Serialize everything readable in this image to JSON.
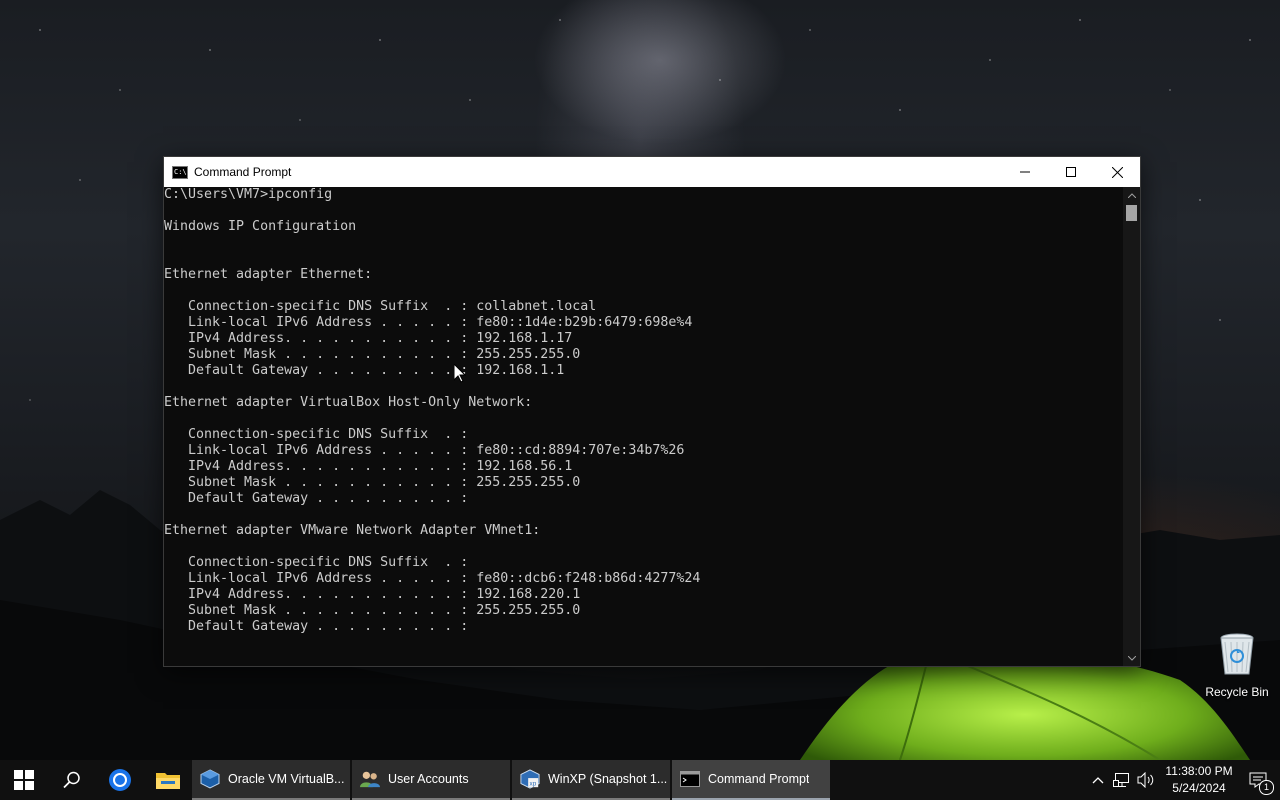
{
  "desktop": {
    "icons": [
      {
        "label": "Recycle Bin",
        "icon": "recycle-bin-icon"
      }
    ]
  },
  "window": {
    "title": "Command Prompt",
    "icon": "console-icon",
    "controls": {
      "minimize": "minimize-icon",
      "maximize": "maximize-icon",
      "close": "close-icon"
    }
  },
  "console": {
    "lines": [
      "C:\\Users\\VM7>ipconfig",
      "",
      "Windows IP Configuration",
      "",
      "",
      "Ethernet adapter Ethernet:",
      "",
      "   Connection-specific DNS Suffix  . : collabnet.local",
      "   Link-local IPv6 Address . . . . . : fe80::1d4e:b29b:6479:698e%4",
      "   IPv4 Address. . . . . . . . . . . : 192.168.1.17",
      "   Subnet Mask . . . . . . . . . . . : 255.255.255.0",
      "   Default Gateway . . . . . . . . . : 192.168.1.1",
      "",
      "Ethernet adapter VirtualBox Host-Only Network:",
      "",
      "   Connection-specific DNS Suffix  . :",
      "   Link-local IPv6 Address . . . . . : fe80::cd:8894:707e:34b7%26",
      "   IPv4 Address. . . . . . . . . . . : 192.168.56.1",
      "   Subnet Mask . . . . . . . . . . . : 255.255.255.0",
      "   Default Gateway . . . . . . . . . :",
      "",
      "Ethernet adapter VMware Network Adapter VMnet1:",
      "",
      "   Connection-specific DNS Suffix  . :",
      "   Link-local IPv6 Address . . . . . : fe80::dcb6:f248:b86d:4277%24",
      "   IPv4 Address. . . . . . . . . . . : 192.168.220.1",
      "   Subnet Mask . . . . . . . . . . . : 255.255.255.0",
      "   Default Gateway . . . . . . . . . :"
    ]
  },
  "taskbar": {
    "start": "windows-start-icon",
    "search": "search-icon",
    "pinned": [
      {
        "name": "chrome",
        "icon": "chrome-icon"
      },
      {
        "name": "file-explorer",
        "icon": "folder-icon"
      }
    ],
    "apps": [
      {
        "label": "Oracle VM VirtualB...",
        "icon": "virtualbox-icon",
        "active": false
      },
      {
        "label": "User Accounts",
        "icon": "user-accounts-icon",
        "active": false
      },
      {
        "label": "WinXP (Snapshot 1...",
        "icon": "vm-xp-icon",
        "active": false
      },
      {
        "label": "Command Prompt",
        "icon": "console-icon",
        "active": true
      }
    ],
    "tray": {
      "icons": [
        "chevron-up-icon",
        "network-icon",
        "speaker-icon"
      ],
      "time": "11:38:00 PM",
      "date": "5/24/2024",
      "notification_count": "1"
    }
  },
  "colors": {
    "console_bg": "#0c0c0c",
    "console_text": "#cccccc",
    "taskbar_bg": "#101010",
    "titlebar_bg": "#ffffff"
  }
}
